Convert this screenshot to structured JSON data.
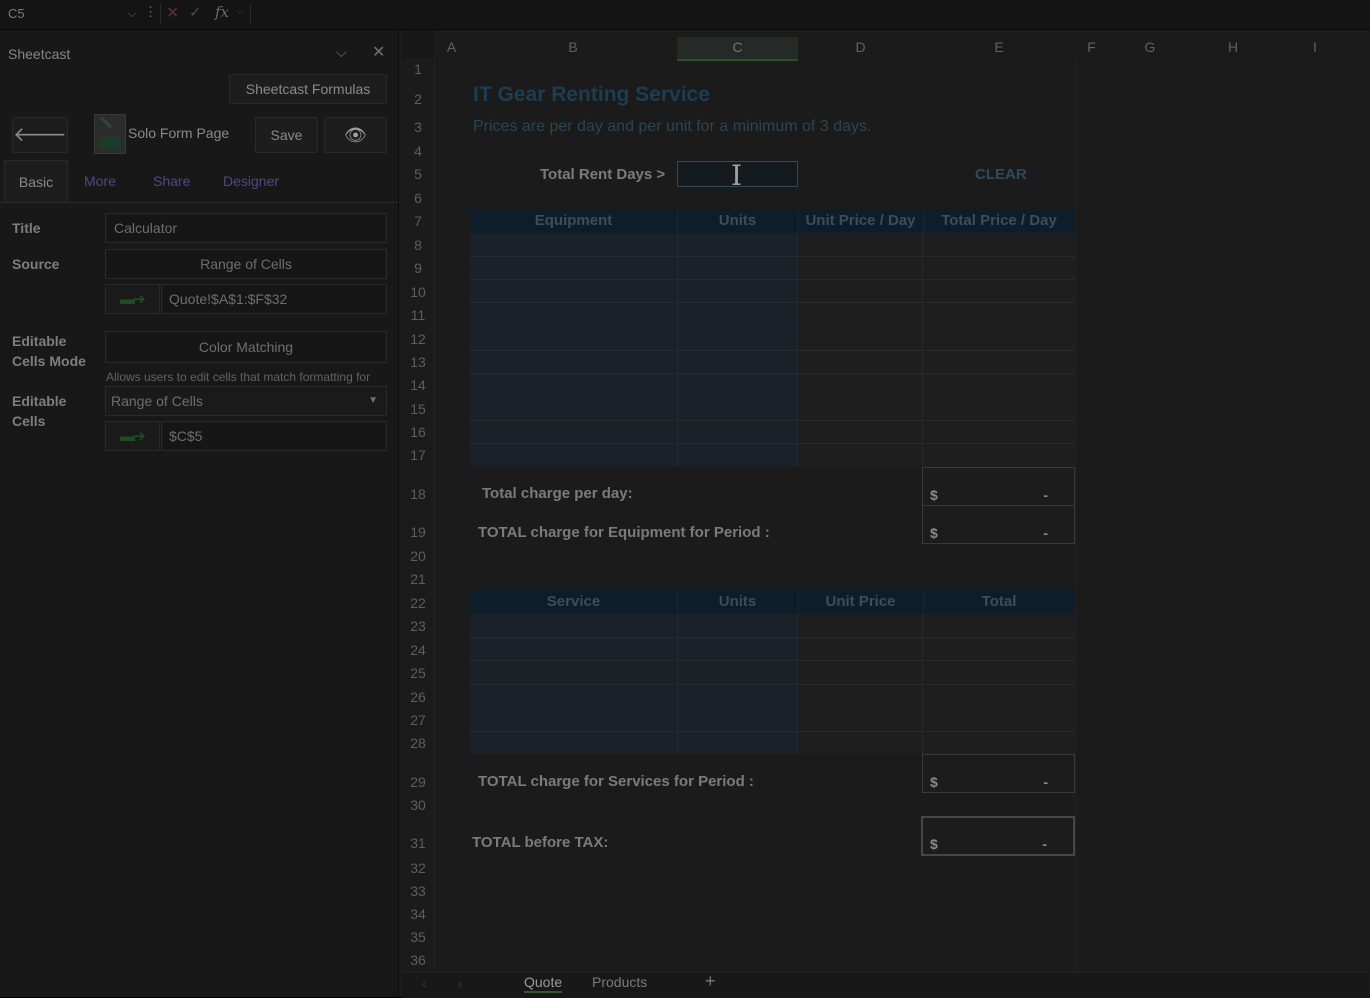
{
  "formula_bar": {
    "cell_ref": "C5",
    "fx": "fx"
  },
  "pane": {
    "title": "Sheetcast",
    "formulas_button": "Sheetcast Formulas",
    "back_button": "🡐",
    "solo_form_label": "Solo Form Page",
    "save_button": "Save",
    "eye_button": "👁",
    "tabs": [
      {
        "label": "Basic"
      },
      {
        "label": "More"
      },
      {
        "label": "Share"
      },
      {
        "label": "Designer"
      }
    ],
    "title_label": "Title",
    "title_value": "Calculator",
    "source_label": "Source",
    "source_mode": "Range of Cells",
    "source_range": "Quote!$A$1:$F$32",
    "editable_mode_label": "Editable Cells Mode",
    "editable_mode_value": "Color Matching",
    "editable_mode_hint": "Allows users to edit cells that match formatting for",
    "editable_cells_label": "Editable Cells",
    "editable_cells_mode": "Range of Cells",
    "editable_cells_range": "$C$5"
  },
  "grid": {
    "columns": [
      "A",
      "B",
      "C",
      "D",
      "E",
      "F",
      "G",
      "H",
      "I"
    ],
    "selected_column": "C",
    "rows": [
      "1",
      "2",
      "3",
      "4",
      "5",
      "6",
      "7",
      "8",
      "9",
      "10",
      "11",
      "12",
      "13",
      "14",
      "15",
      "16",
      "17",
      "18",
      "19",
      "20",
      "21",
      "22",
      "23",
      "24",
      "25",
      "26",
      "27",
      "28",
      "29",
      "30",
      "31",
      "32",
      "33",
      "34",
      "35",
      "36"
    ],
    "title": "IT Gear Renting Service",
    "subtitle": "Prices are per day and per unit for a minimum of 3 days.",
    "total_rent_days_label": "Total Rent Days >",
    "clear_label": "CLEAR",
    "equipment_headers": [
      "Equipment",
      "Units",
      "Unit Price / Day",
      "Total Price / Day"
    ],
    "total_charge_day_label": "Total charge per day:",
    "total_equipment_label": "TOTAL charge for Equipment for Period :",
    "service_headers": [
      "Service",
      "Units",
      "Unit Price",
      "Total"
    ],
    "total_services_label": "TOTAL charge for Services for Period :",
    "total_before_tax_label": "TOTAL before TAX:",
    "currency": "$",
    "empty_amount": "-"
  },
  "sheet_tabs": [
    {
      "label": "Quote",
      "active": true
    },
    {
      "label": "Products",
      "active": false
    }
  ],
  "add_sheet": "+"
}
